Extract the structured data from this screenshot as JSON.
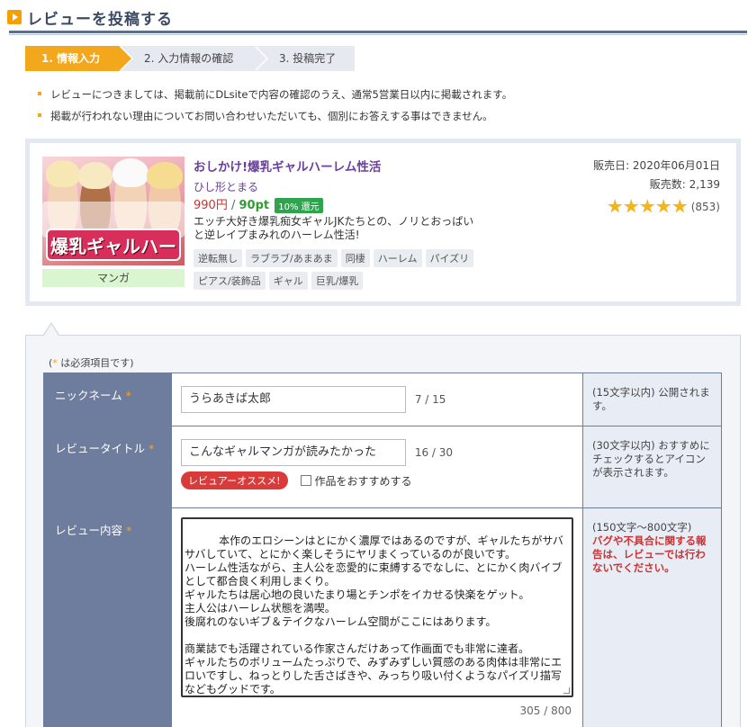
{
  "page": {
    "title": "レビューを投稿する"
  },
  "steps": [
    {
      "label": "1. 情報入力",
      "active": true
    },
    {
      "label": "2. 入力情報の確認",
      "active": false
    },
    {
      "label": "3. 投稿完了",
      "active": false
    }
  ],
  "notes": [
    "レビューにつきましては、掲載前にDLsiteで内容の確認のうえ、通常5営業日以内に掲載されます。",
    "掲載が行われない理由についてお問い合わせいただいても、個別にお答えする事はできません。"
  ],
  "product": {
    "title": "おしかけ!爆乳ギャルハーレム性活",
    "thumb_logo": "爆乳ギャルハーレム性活",
    "category": "マンガ",
    "circle": "ひし形とまる",
    "price": "990円",
    "price_sep": "/",
    "points": "90pt",
    "discount_badge": "10% 還元",
    "description": "エッチ大好き爆乳痴女ギャルJKたちとの、ノリとおっぱいと逆レイプまみれのハーレム性活!",
    "tags": [
      "逆転無し",
      "ラブラブ/あまあま",
      "同棲",
      "ハーレム",
      "パイズリ",
      "ピアス/装飾品",
      "ギャル",
      "巨乳/爆乳"
    ],
    "release_date": "販売日: 2020年06月01日",
    "sales_count": "販売数: 2,139",
    "rating_stars": 5,
    "rating_count": "(853)"
  },
  "form": {
    "required_note_open": "(",
    "required_note_asterisk": "*",
    "required_note_text": " は必須項目です)",
    "nickname": {
      "label": "ニックネーム",
      "value": "うらあきば太郎",
      "count": "7 / 15",
      "hint": "(15文字以内) 公開されます。"
    },
    "review_title": {
      "label": "レビュータイトル",
      "value": "こんなギャルマンガが読みたかった",
      "count": "16 / 30",
      "recommend_badge": "レビュアーオススメ!",
      "recommend_checkbox_label": "作品をおすすめする",
      "hint": "(30文字以内) おすすめにチェックするとアイコンが表示されます。"
    },
    "review_body": {
      "label": "レビュー内容",
      "value": "本作のエロシーンはとにかく濃厚ではあるのですが、ギャルたちがサバサバしていて、とにかく楽しそうにヤリまくっているのが良いです。\nハーレム性活ながら、主人公を恋愛的に束縛するでなしに、とにかく肉バイブとして都合良く利用しまくり。\nギャルたちは居心地の良いたまり場とチンポをイカせる快楽をゲット。\n主人公はハーレム状態を満喫。\n後腐れのないギブ＆テイクなハーレム空間がここにはあります。\n\n商業誌でも活躍されている作家さんだけあって作画面でも非常に達者。\nギャルたちのボリュームたっぷりで、みずみずしい質感のある肉体は非常にエロいですし、ねっとりした舌さばきや、みっちり吸い付くようなパイズリ描写などもグッドです。",
      "count": "305 / 800",
      "hint_range": "(150文字～800文字)",
      "hint_warning": "バグや不具合に関する報告は、レビューでは行わないでください。"
    },
    "asterisk": "*"
  },
  "colors": {
    "accent": "#f3a71d",
    "header_navy": "#3c4b64",
    "label_bg": "#6e7c9d",
    "warn": "#d03030",
    "title_purple": "#6b3fa0"
  }
}
